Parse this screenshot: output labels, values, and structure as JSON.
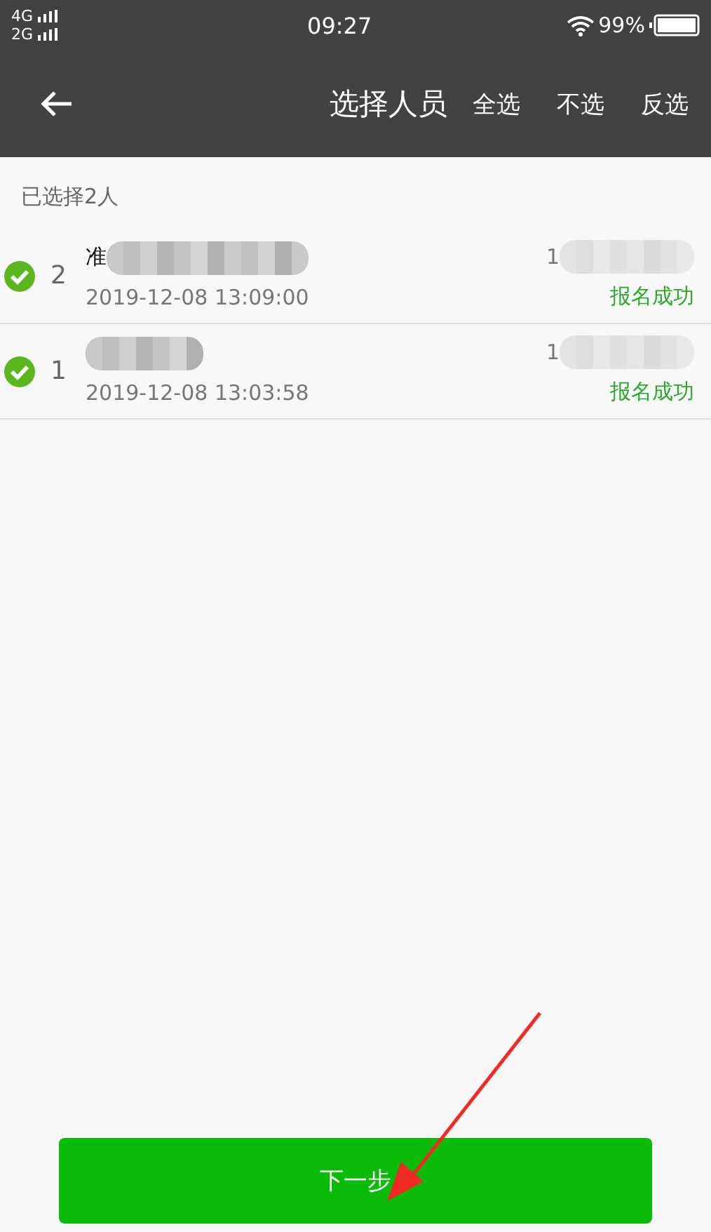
{
  "status_bar": {
    "networks": [
      "4G",
      "2G"
    ],
    "time": "09:27",
    "battery": "99%"
  },
  "header": {
    "title": "选择人员",
    "actions": [
      "全选",
      "不选",
      "反选"
    ]
  },
  "summary": "已选择2人",
  "rows": [
    {
      "checked": true,
      "index": "2",
      "name": "准",
      "phone": "1",
      "time": "2019-12-08 13:09:00",
      "status": "报名成功"
    },
    {
      "checked": true,
      "index": "1",
      "phone": "1",
      "time": "2019-12-08 13:03:58",
      "status": "报名成功"
    }
  ],
  "next_button": "下一步"
}
